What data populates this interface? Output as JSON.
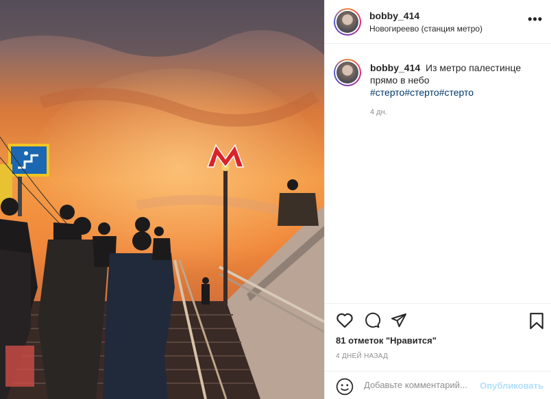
{
  "post": {
    "username": "bobby_414",
    "location": "Новогиреево (станция метро)",
    "more_icon": "more-horizontal-icon",
    "photo_alt": "Станция метро на закате",
    "caption": {
      "username": "bobby_414",
      "text": "Из метро палестинце прямо в небо",
      "hashtags": "#стерто#стерто#стерто",
      "time": "4 дн."
    },
    "likes": "81 отметок \"Нравится\"",
    "date": "4 ДНЕЙ НАЗАД",
    "comment": {
      "placeholder": "Добавьте комментарий...",
      "publish_label": "Опубликовать"
    },
    "icons": [
      "heart-icon",
      "comment-icon",
      "share-icon",
      "bookmark-icon",
      "emoji-icon"
    ]
  },
  "colors": {
    "sky_top": "#6b5a62",
    "sky_glow": "#f08a38",
    "metro_red": "#d9232a",
    "publish_blue": "#b2dffc",
    "hashtag": "#00376b"
  }
}
